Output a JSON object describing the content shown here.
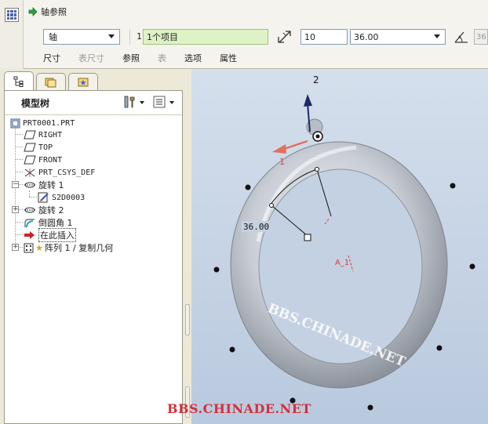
{
  "dashboard": {
    "title": "轴参照",
    "ref_type": "轴",
    "ref_count": "1",
    "ref_collector": "1个项目",
    "increment": "10",
    "angle": "36.00",
    "count": "36",
    "tabs": [
      {
        "label": "尺寸",
        "enabled": true
      },
      {
        "label": "表尺寸",
        "enabled": false
      },
      {
        "label": "参照",
        "enabled": true
      },
      {
        "label": "表",
        "enabled": false
      },
      {
        "label": "选项",
        "enabled": true
      },
      {
        "label": "属性",
        "enabled": true
      }
    ]
  },
  "navigator": {
    "title": "模型树",
    "tree": [
      {
        "label": "PRT0001.PRT",
        "icon": "part-icon"
      },
      {
        "label": "RIGHT",
        "icon": "datum-plane-icon"
      },
      {
        "label": "TOP",
        "icon": "datum-plane-icon"
      },
      {
        "label": "FRONT",
        "icon": "datum-plane-icon"
      },
      {
        "label": "PRT_CSYS_DEF",
        "icon": "csys-icon"
      },
      {
        "label": "旋转 1",
        "icon": "revolve-icon"
      },
      {
        "label": "S2D0003",
        "icon": "sketch-icon"
      },
      {
        "label": "旋转 2",
        "icon": "revolve-icon"
      },
      {
        "label": "倒圆角 1",
        "icon": "round-icon"
      },
      {
        "label": "在此插入",
        "icon": "insert-here-icon"
      },
      {
        "label": "阵列 1 / 复制几何",
        "icon": "pattern-icon"
      }
    ]
  },
  "graphics": {
    "axis_label": "2",
    "angle_label": "36.00",
    "direction_label": "1",
    "axis_tag": "A_1",
    "watermark_ring": "BBS.CHINADE.NET",
    "watermark_bottom": "BBS.CHINADE.NET",
    "colors": {
      "background_top": "#d5dfec",
      "background_bottom": "#b9c9de",
      "ring": "#c7ccd4",
      "axis_arrow": "#1a2a6a",
      "direction_arrow": "#e07060",
      "axis_tag": "#d83a3a",
      "watermark": "#d3303a"
    }
  }
}
